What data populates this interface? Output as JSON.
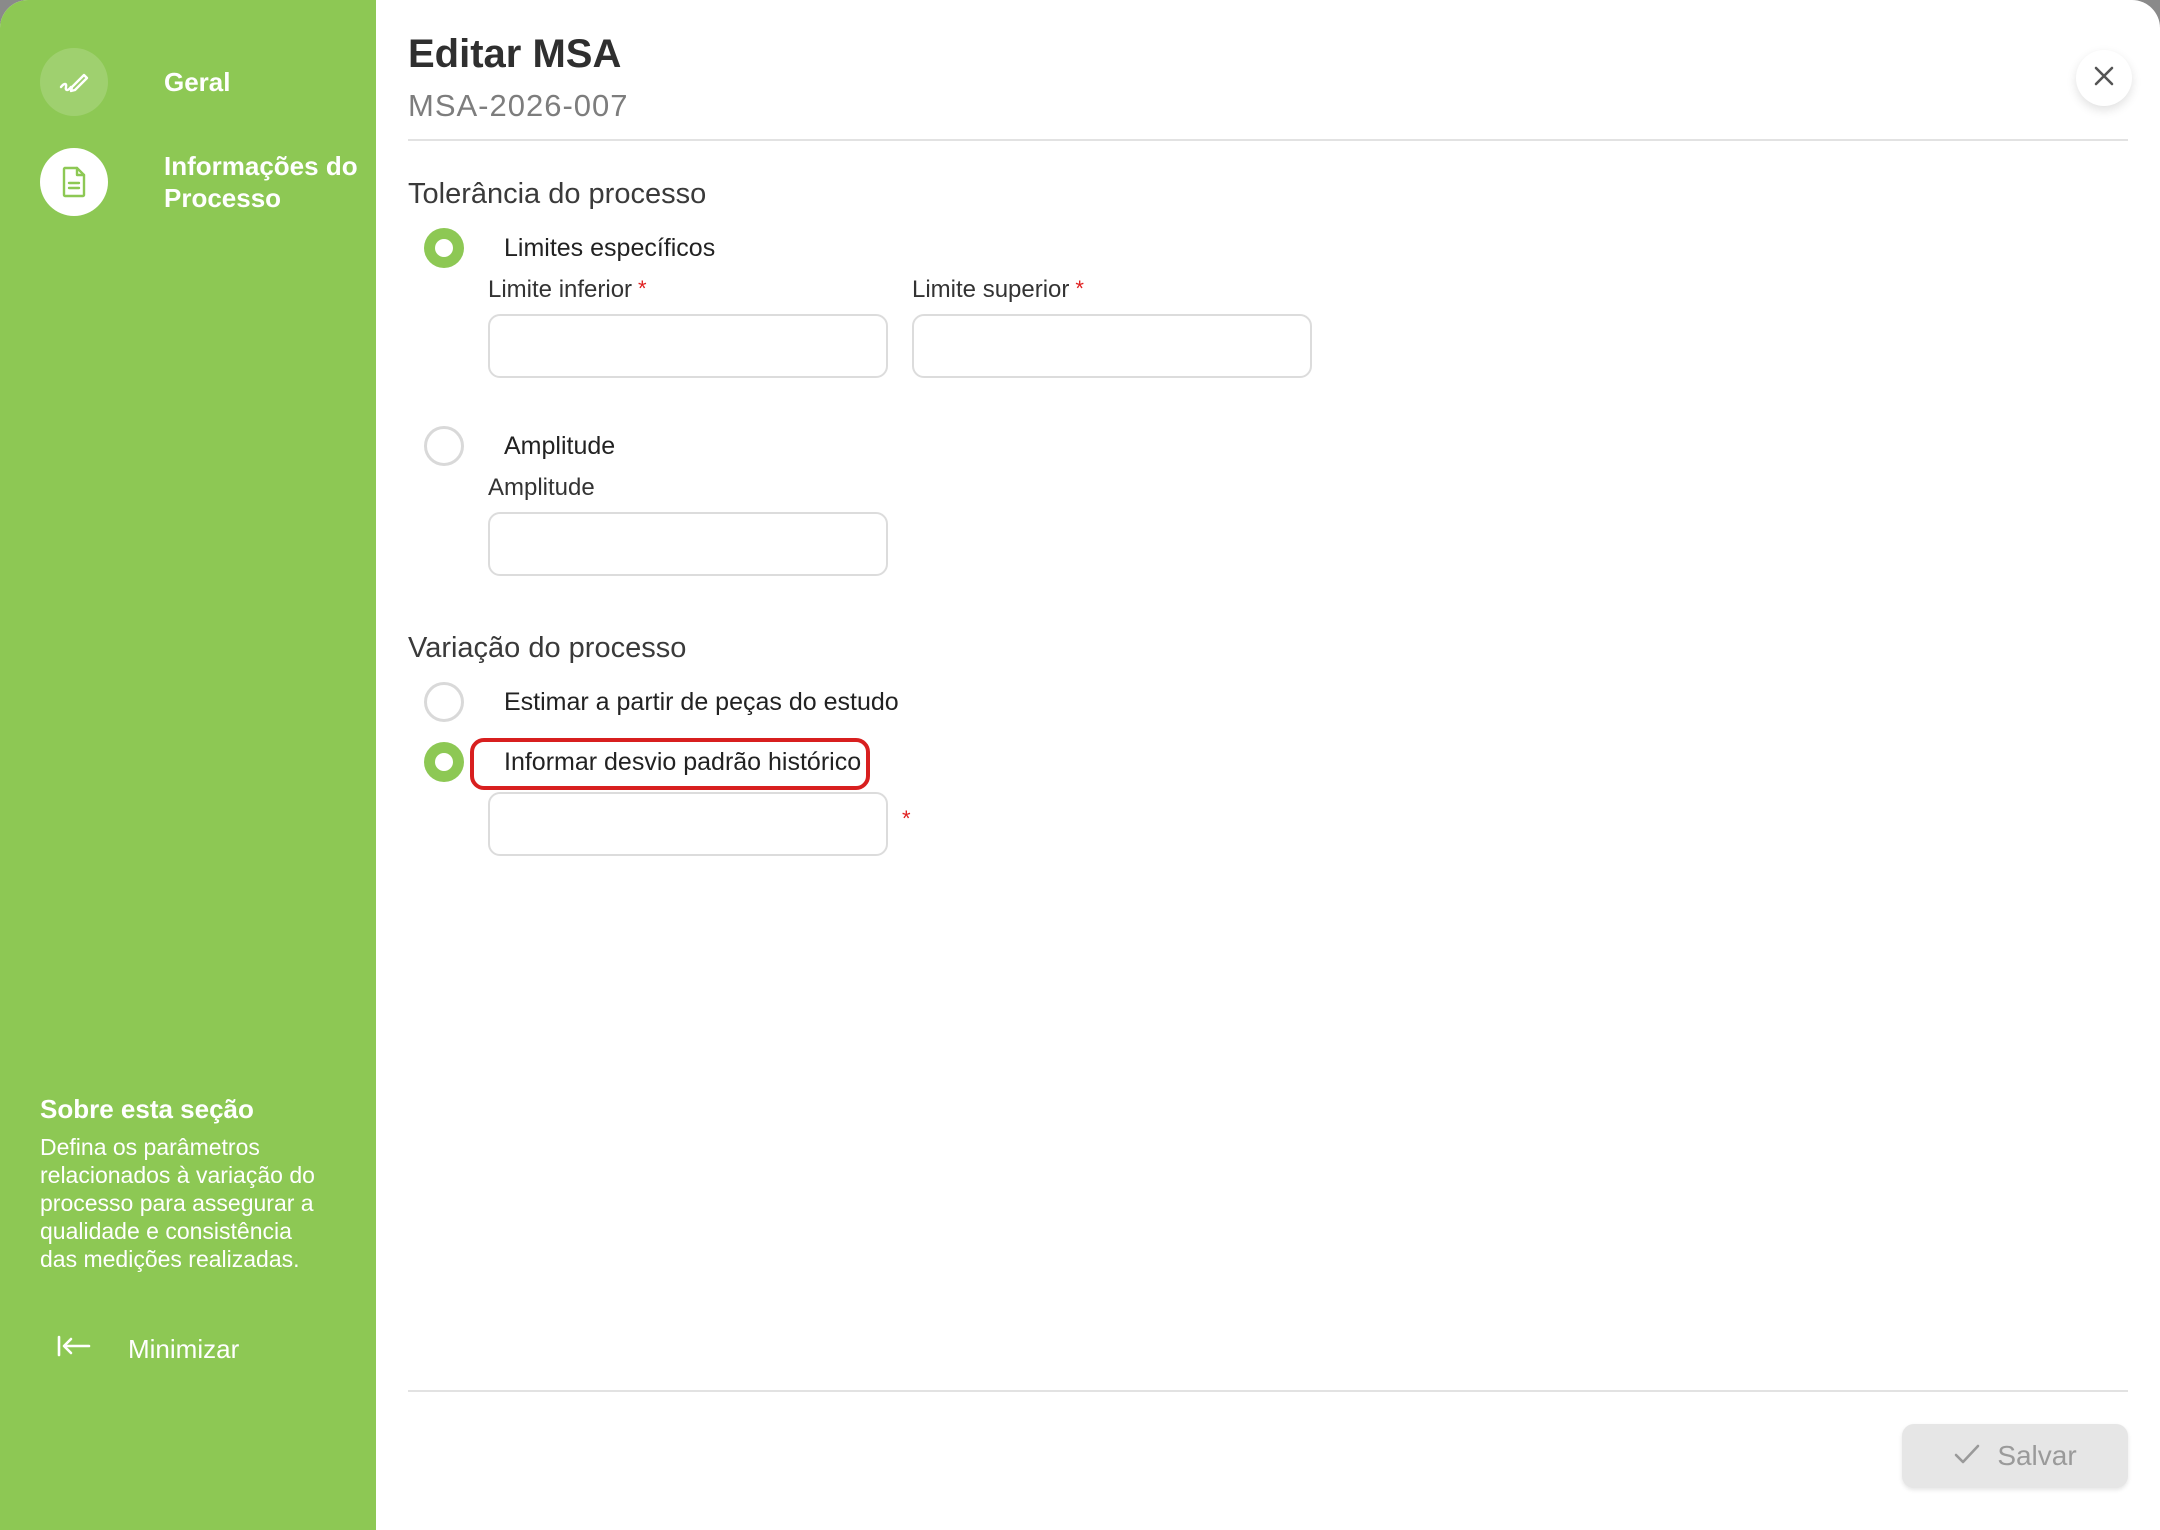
{
  "sidebar": {
    "steps": [
      {
        "label": "Geral",
        "icon": "edit-check-icon",
        "state": "done"
      },
      {
        "label": "Informações do Processo",
        "icon": "document-icon",
        "state": "active"
      }
    ],
    "about_title": "Sobre esta seção",
    "about_text": "Defina os parâmetros relacionados à variação do processo para assegurar a qualidade e consistência das medições realizadas.",
    "minimize_label": "Minimizar",
    "minimize_icon": "collapse-left-icon"
  },
  "header": {
    "title": "Editar MSA",
    "subtitle": "MSA-2026-007",
    "close_icon": "close-icon"
  },
  "tolerance": {
    "title": "Tolerância do processo",
    "options": [
      {
        "label": "Limites específicos",
        "checked": true
      },
      {
        "label": "Amplitude",
        "checked": false
      }
    ],
    "lower_label": "Limite inferior",
    "upper_label": "Limite superior",
    "amplitude_label": "Amplitude",
    "lower_value": "",
    "upper_value": "",
    "amplitude_value": "",
    "required_mark": "*"
  },
  "variation": {
    "title": "Variação do processo",
    "options": [
      {
        "label": "Estimar a partir de peças do estudo",
        "checked": false
      },
      {
        "label": "Informar desvio padrão histórico",
        "checked": true
      }
    ],
    "stddev_value": "",
    "required_mark": "*"
  },
  "footer": {
    "save_label": "Salvar",
    "save_icon": "check-icon",
    "save_disabled": true
  },
  "colors": {
    "accent": "#8dc854",
    "required": "#e02020",
    "highlight": "#d81f1f"
  }
}
